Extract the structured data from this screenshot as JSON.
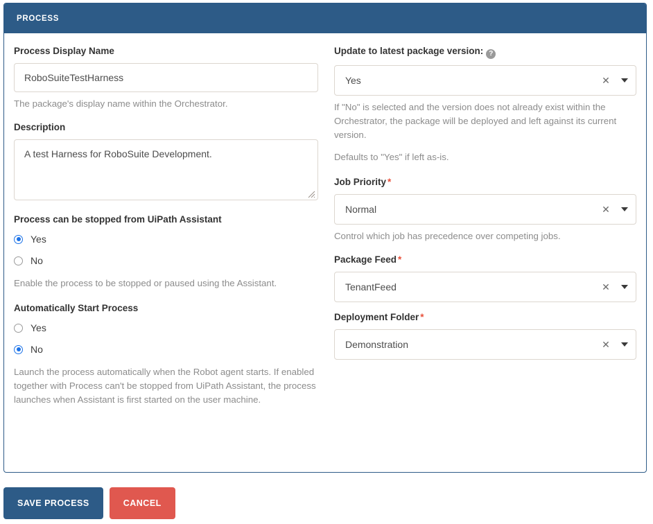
{
  "card": {
    "header_title": "PROCESS"
  },
  "left": {
    "display_name": {
      "label": "Process Display Name",
      "value": "RoboSuiteTestHarness",
      "placeholder": "",
      "help": "The package's display name within the Orchestrator."
    },
    "description": {
      "label": "Description",
      "value": "A test Harness for RoboSuite Development.",
      "placeholder": ""
    },
    "can_be_stopped": {
      "label": "Process can be stopped from UiPath Assistant",
      "options": [
        {
          "label": "Yes",
          "selected": true
        },
        {
          "label": "No",
          "selected": false
        }
      ],
      "help": "Enable the process to be stopped or paused using the Assistant."
    },
    "auto_start": {
      "label": "Automatically Start Process",
      "options": [
        {
          "label": "Yes",
          "selected": false
        },
        {
          "label": "No",
          "selected": true
        }
      ],
      "help": "Launch the process automatically when the Robot agent starts. If enabled together with Process can't be stopped from UiPath Assistant, the process launches when Assistant is first started on the user machine."
    }
  },
  "right": {
    "update_version": {
      "label": "Update to latest package version:",
      "help_icon": "question-mark-circle-icon",
      "value": "Yes",
      "clear_icon": "close-icon",
      "caret_icon": "chevron-down-icon",
      "help1": "If \"No\" is selected and the version does not already exist within the Orchestrator, the package will be deployed and left against its current version.",
      "help2": "Defaults to \"Yes\" if left as-is."
    },
    "job_priority": {
      "label": "Job Priority",
      "required_mark": "*",
      "value": "Normal",
      "clear_icon": "close-icon",
      "caret_icon": "chevron-down-icon",
      "help": "Control which job has precedence over competing jobs."
    },
    "package_feed": {
      "label": "Package Feed",
      "required_mark": "*",
      "value": "TenantFeed",
      "clear_icon": "close-icon",
      "caret_icon": "chevron-down-icon"
    },
    "deployment_folder": {
      "label": "Deployment Folder",
      "required_mark": "*",
      "value": "Demonstration",
      "clear_icon": "close-icon",
      "caret_icon": "chevron-down-icon"
    }
  },
  "footer": {
    "save_label": "SAVE PROCESS",
    "cancel_label": "CANCEL"
  },
  "colors": {
    "header_blue": "#2d5b87",
    "cancel_red": "#e0584f",
    "required_red": "#e8503a",
    "radio_blue": "#1b72e8",
    "input_border": "#dcd6cf",
    "help_text": "#8c8c8c"
  }
}
